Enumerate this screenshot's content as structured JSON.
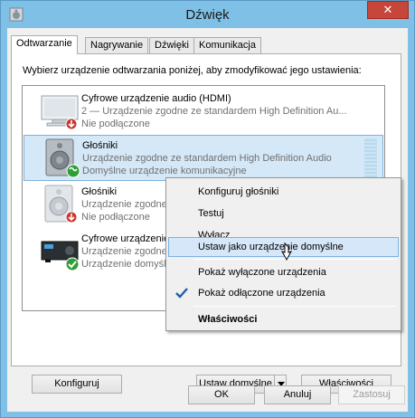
{
  "window": {
    "title": "Dźwięk",
    "close_label": "✕"
  },
  "tabs": [
    {
      "label": "Odtwarzanie",
      "active": true
    },
    {
      "label": "Nagrywanie",
      "active": false
    },
    {
      "label": "Dźwięki",
      "active": false
    },
    {
      "label": "Komunikacja",
      "active": false
    }
  ],
  "instructions": "Wybierz urządzenie odtwarzania poniżej, aby zmodyfikować jego ustawienia:",
  "devices": [
    {
      "name": "Cyfrowe urządzenie audio (HDMI)",
      "description": "2 — Urządzenie zgodne ze standardem High Definition Au...",
      "status": "Nie podłączone",
      "icon": "monitor-icon",
      "badge": "disconnected-badge"
    },
    {
      "name": "Głośniki",
      "description": "Urządzenie zgodne ze standardem High Definition Audio",
      "status": "Domyślne urządzenie komunikacyjne",
      "icon": "speaker-icon",
      "badge": "phone-badge",
      "selected": true
    },
    {
      "name": "Głośniki",
      "description": "Urządzenie zgodne ze standardem High Definition Audio",
      "status": "Nie podłączone",
      "icon": "speaker-icon",
      "badge": "disconnected-badge"
    },
    {
      "name": "Cyfrowe urządzenie audio",
      "description": "Urządzenie zgodne ze standardem High Definition Audio",
      "status": "Urządzenie domyślne",
      "icon": "receiver-icon",
      "badge": "default-check-badge"
    }
  ],
  "buttons": {
    "configure": "Konfiguruj",
    "set_default": "Ustaw domyślne",
    "properties": "Właściwości",
    "ok": "OK",
    "cancel": "Anuluj",
    "apply": "Zastosuj"
  },
  "context_menu": {
    "items": [
      {
        "label": "Konfiguruj głośniki"
      },
      {
        "label": "Testuj"
      },
      {
        "label": "Wyłącz"
      },
      {
        "label": "Ustaw jako urządzenie domyślne",
        "highlighted": true
      },
      {
        "label": "Pokaż wyłączone urządzenia"
      },
      {
        "label": "Pokaż odłączone urządzenia",
        "checked": true
      },
      {
        "label": "Właściwości",
        "bold": true
      }
    ]
  },
  "colors": {
    "title_bar": "#7fc0e6",
    "selection": "#d5e8f7",
    "close": "#c7463a"
  }
}
